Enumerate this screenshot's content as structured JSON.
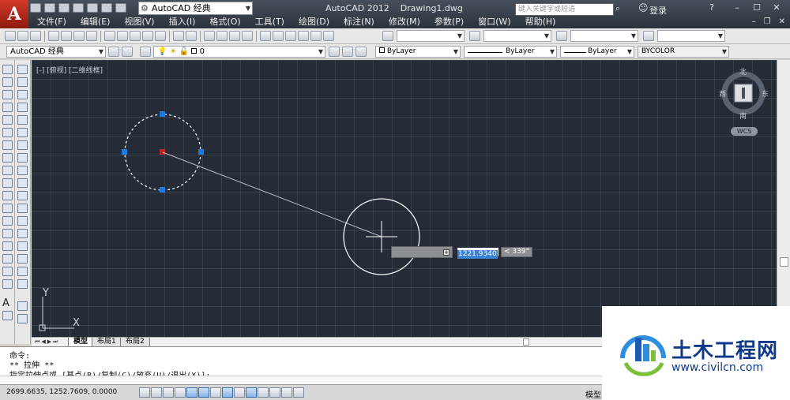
{
  "window": {
    "app_title": "AutoCAD 2012    Drawing1.dwg",
    "workspace": "AutoCAD 经典",
    "search_placeholder": "键入关键字或短语",
    "login_label": "登录",
    "menu": [
      "文件(F)",
      "编辑(E)",
      "视图(V)",
      "插入(I)",
      "格式(O)",
      "工具(T)",
      "绘图(D)",
      "标注(N)",
      "修改(M)",
      "参数(P)",
      "窗口(W)",
      "帮助(H)"
    ]
  },
  "toolbar2": {
    "workspace": "AutoCAD 经典",
    "layer": "0",
    "color": "ByLayer",
    "linetype": "ByLayer",
    "lineweight": "ByLayer",
    "plotstyle": "BYCOLOR"
  },
  "viewport": {
    "label": "[-] [俯视] [二维线框]",
    "viewcube": {
      "north": "北",
      "south": "南",
      "west": "西",
      "east": "东",
      "wcs": "WCS"
    },
    "ucs": {
      "x": "X",
      "y": "Y"
    },
    "dynamic_input": {
      "length": "1221.9340",
      "angle": "< 339°"
    }
  },
  "layout_tabs": [
    "模型",
    "布局1",
    "布局2"
  ],
  "command_line": {
    "lines": [
      "命令:",
      "** 拉伸 **",
      "指定拉伸点或 [基点(B)/复制(C)/放弃(U)/退出(X)]:"
    ]
  },
  "status": {
    "coords": "2699.6635, 1252.7609, 0.0000",
    "model_label": "模型"
  },
  "watermark": {
    "name": "土木工程网",
    "url": "www.civilcn.com"
  },
  "colors": {
    "canvas": "#252c36",
    "grip": "#1a7ce0",
    "accent": "#3a82d6"
  }
}
